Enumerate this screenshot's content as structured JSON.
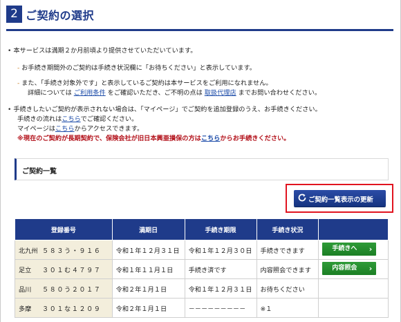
{
  "header": {
    "step": "2",
    "title": "ご契約の選択"
  },
  "notes": {
    "line1": "本サービスは満期２か月前頃より提供させていただいています。",
    "line2": "お手続き期間外のご契約は手続き状況欄に「お待ちください」と表示しています。",
    "line3": "また、「手続き対象外です」と表示しているご契約は本サービスをご利用になれません。",
    "line4_a": "詳細については",
    "line4_link1": "ご利用条件",
    "line4_b": "をご確認いただき、ご不明の点は",
    "line4_link2": "取扱代理店",
    "line4_c": "までお問い合わせください。",
    "line5": "手続きしたいご契約が表示されない場合は、「マイページ」でご契約を追加登録のうえ、お手続きください。",
    "line6_a": "手続きの流れは",
    "line6_link": "こちら",
    "line6_b": "でご確認ください。",
    "line7_a": "マイページは",
    "line7_link": "こちら",
    "line7_b": "からアクセスできます。",
    "warn_a": "※現在のご契約が長期契約で、保険会社が旧日本興亜損保の方は",
    "warn_link": "こちら",
    "warn_b": "からお手続きください。"
  },
  "panel": {
    "title": "ご契約一覧"
  },
  "refresh_button": {
    "label": "ご契約一覧表示の更新",
    "icon": "refresh-icon"
  },
  "table": {
    "headers": [
      "登録番号",
      "満期日",
      "手続き期限",
      "手続き状況",
      ""
    ],
    "rows": [
      {
        "plate": "北九州",
        "number": "５８３う・９１６",
        "expiry": "令和１年１２月３１日",
        "deadline": "令和１年１２月３０日",
        "status": "手続きできます",
        "action": "手続きへ"
      },
      {
        "plate": "足立",
        "number": "３０１む４７９７",
        "expiry": "令和１年１１月１日",
        "deadline": "手続き済です",
        "status": "内容照会できます",
        "action": "内容照会"
      },
      {
        "plate": "品川",
        "number": "５８０う２０１７",
        "expiry": "令和２年１月１日",
        "deadline": "令和１年１２月３１日",
        "status": "お待ちください",
        "action": ""
      },
      {
        "plate": "多摩",
        "number": "３０１な１２０９",
        "expiry": "令和２年１月１日",
        "deadline": "－－－－－－－－－",
        "status": "※１",
        "action": ""
      }
    ]
  },
  "colors": {
    "primary": "#1f3b8a",
    "action_green": "#23892d",
    "highlight_red": "#e1131f",
    "warning": "#b3121b",
    "link": "#1a4aa8"
  }
}
